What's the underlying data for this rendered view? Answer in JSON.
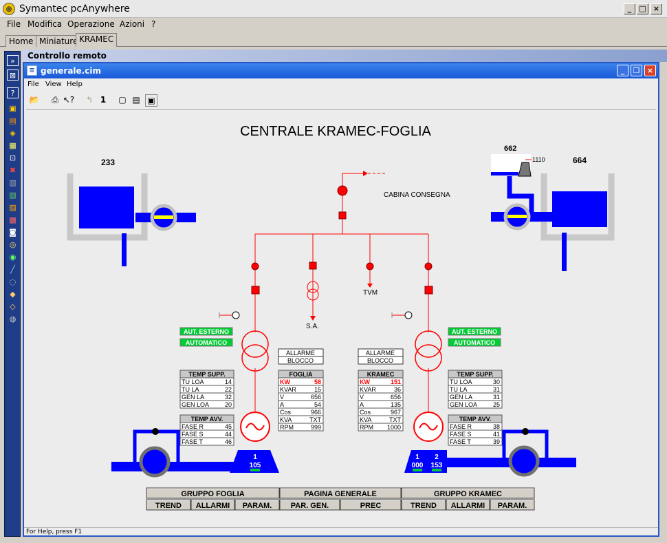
{
  "window": {
    "title": "Symantec pcAnywhere",
    "app_icon": "pcanywhere-icon"
  },
  "menu": [
    "File",
    "Modifica",
    "Operazione",
    "Azioni",
    "?"
  ],
  "tabs": [
    "Home",
    "Miniature",
    "KRAMEC"
  ],
  "remote_bar": "Controllo remoto",
  "child": {
    "title": "generale.cim",
    "menu": [
      "File",
      "View",
      "Help"
    ],
    "toolbar_page": "1",
    "status": "For Help, press F1"
  },
  "diagram": {
    "title": "CENTRALE KRAMEC-FOGLIA",
    "tank_left_label": "233",
    "tank_right_label": "664",
    "tank_small_label": "662",
    "tank_small_value": "1110",
    "cabina": "CABINA CONSEGNA",
    "sa": "S.A.",
    "tvm": "TVM",
    "aut_esterno": "AUT. ESTERNO",
    "automatico": "AUTOMATICO",
    "allarme": "ALLARME",
    "blocco": "BLOCCO",
    "temp_supp": "TEMP SUPP.",
    "temp_avv": "TEMP AVV.",
    "left": {
      "name": "FOGLIA",
      "temp_supp": [
        [
          "TU LOA",
          "14"
        ],
        [
          "TU LA",
          "22"
        ],
        [
          "GEN LA",
          "32"
        ],
        [
          "GEN LOA",
          "20"
        ]
      ],
      "temp_avv": [
        [
          "FASE R",
          "45"
        ],
        [
          "FASE S",
          "44"
        ],
        [
          "FASE T",
          "46"
        ]
      ],
      "kw": [
        "KW",
        "58"
      ],
      "params": [
        [
          "KVAR",
          "15"
        ],
        [
          "V",
          "656"
        ],
        [
          "A",
          "54"
        ],
        [
          "Cos",
          "966"
        ],
        [
          "KVA",
          "TXT"
        ],
        [
          "RPM",
          "999"
        ]
      ],
      "unit_top": "1",
      "unit_bottom": "105"
    },
    "right": {
      "name": "KRAMEC",
      "temp_supp": [
        [
          "TU LOA",
          "30"
        ],
        [
          "TU LA",
          "31"
        ],
        [
          "GEN LA",
          "31"
        ],
        [
          "GEN LOA",
          "25"
        ]
      ],
      "temp_avv": [
        [
          "FASE R",
          "38"
        ],
        [
          "FASE S",
          "41"
        ],
        [
          "FASE T",
          "39"
        ]
      ],
      "kw": [
        "KW",
        "151"
      ],
      "params": [
        [
          "KVAR",
          "36"
        ],
        [
          "V",
          "656"
        ],
        [
          "A",
          "135"
        ],
        [
          "Cos",
          "967"
        ],
        [
          "KVA",
          "TXT"
        ],
        [
          "RPM",
          "1000"
        ]
      ],
      "unit1_top": "1",
      "unit1_bottom": "000",
      "unit2_top": "2",
      "unit2_bottom": "153"
    },
    "nav": {
      "row1": [
        "GRUPPO FOGLIA",
        "PAGINA GENERALE",
        "GRUPPO KRAMEC"
      ],
      "row2": [
        "TREND",
        "ALLARMI",
        "PARAM.",
        "PAR. GEN.",
        "PREC",
        "TREND",
        "ALLARMI",
        "PARAM."
      ]
    }
  },
  "colors": {
    "blue": "#0000ff",
    "red": "#ff0000",
    "green": "#00cc33",
    "gray": "#c8c8c8"
  }
}
